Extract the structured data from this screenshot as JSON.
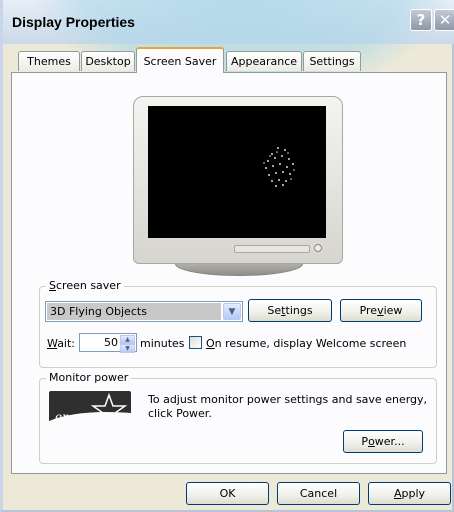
{
  "window": {
    "title": "Display Properties",
    "help_label": "?",
    "close_label": "✕"
  },
  "tabs": [
    {
      "label": "Themes"
    },
    {
      "label": "Desktop"
    },
    {
      "label": "Screen Saver",
      "active": true
    },
    {
      "label": "Appearance"
    },
    {
      "label": "Settings"
    }
  ],
  "screen_saver": {
    "group_label_hotkey": "S",
    "group_label_rest": "creen saver",
    "selected": "3D Flying Objects",
    "settings_pre": "Se",
    "settings_hotkey": "t",
    "settings_post": "tings",
    "preview_pre": "Pre",
    "preview_hotkey": "v",
    "preview_post": "iew",
    "wait_hotkey": "W",
    "wait_rest": "ait:",
    "wait_value": "50",
    "minutes_label": "minutes",
    "resume_hotkey": "O",
    "resume_rest": "n resume, display Welcome screen",
    "resume_checked": false
  },
  "monitor_power": {
    "group_label": "Monitor power",
    "description": "To adjust monitor power settings and save energy, click Power.",
    "power_pre": "P",
    "power_hotkey": "o",
    "power_post": "wer...",
    "logo_text": "energy"
  },
  "footer": {
    "ok_label": "OK",
    "cancel_label": "Cancel",
    "apply_hotkey": "A",
    "apply_rest": "pply"
  },
  "colors": {
    "window_bg": "#ece9d8",
    "panel_bg": "#fcfcfe",
    "active_tab_accent": "#e8a33d",
    "button_border": "#003c74"
  }
}
